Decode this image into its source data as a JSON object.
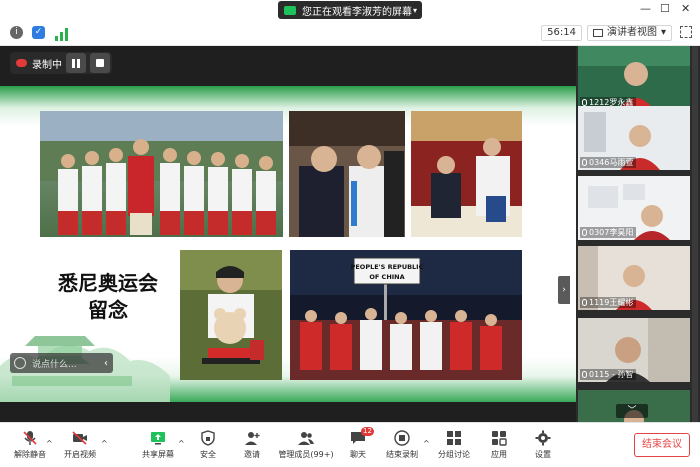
{
  "banner": {
    "share_text": "您正在观看李淑芳的屏幕",
    "caret": "▾"
  },
  "window_controls": {
    "minimize": "—",
    "maximize": "☐",
    "close": "✕"
  },
  "toolbar": {
    "timer": "56:14",
    "view_label": "演讲者视图",
    "view_caret": "▾",
    "info_glyph": "i",
    "shield_glyph": "✓"
  },
  "recording": {
    "label": "录制中"
  },
  "slide": {
    "title_line1": "悉尼奥运会",
    "title_line2": "留念",
    "flag_line1": "PEOPLE'S REPUBLIC",
    "flag_line2": "OF CHINA"
  },
  "chat_float": {
    "placeholder": "说点什么...",
    "collapse_glyph": "‹"
  },
  "side_panel": {
    "expand_glyph": "›",
    "scroll_up_glyph": "︿",
    "scroll_down_glyph": "﹀",
    "participants": [
      {
        "name": "1212罗永鑫"
      },
      {
        "name": "0346马雨萱"
      },
      {
        "name": "0307李昊阳"
      },
      {
        "name": "1119王耀彬"
      },
      {
        "name": "0115 - 孙智"
      }
    ]
  },
  "bottom_bar": {
    "unmute": "解除静音",
    "start_video": "开启视频",
    "share_screen": "共享屏幕",
    "security": "安全",
    "invite": "邀请",
    "participants": "管理成员(99+)",
    "chat": "聊天",
    "chat_badge": "12",
    "end_recording": "结束录制",
    "breakout": "分组讨论",
    "apps": "应用",
    "settings": "设置",
    "end_meeting": "结束会议",
    "caret": "^"
  },
  "colors": {
    "accent_green": "#1ec15a",
    "danger_red": "#e64545",
    "panel_dark": "#2b2b2b"
  }
}
